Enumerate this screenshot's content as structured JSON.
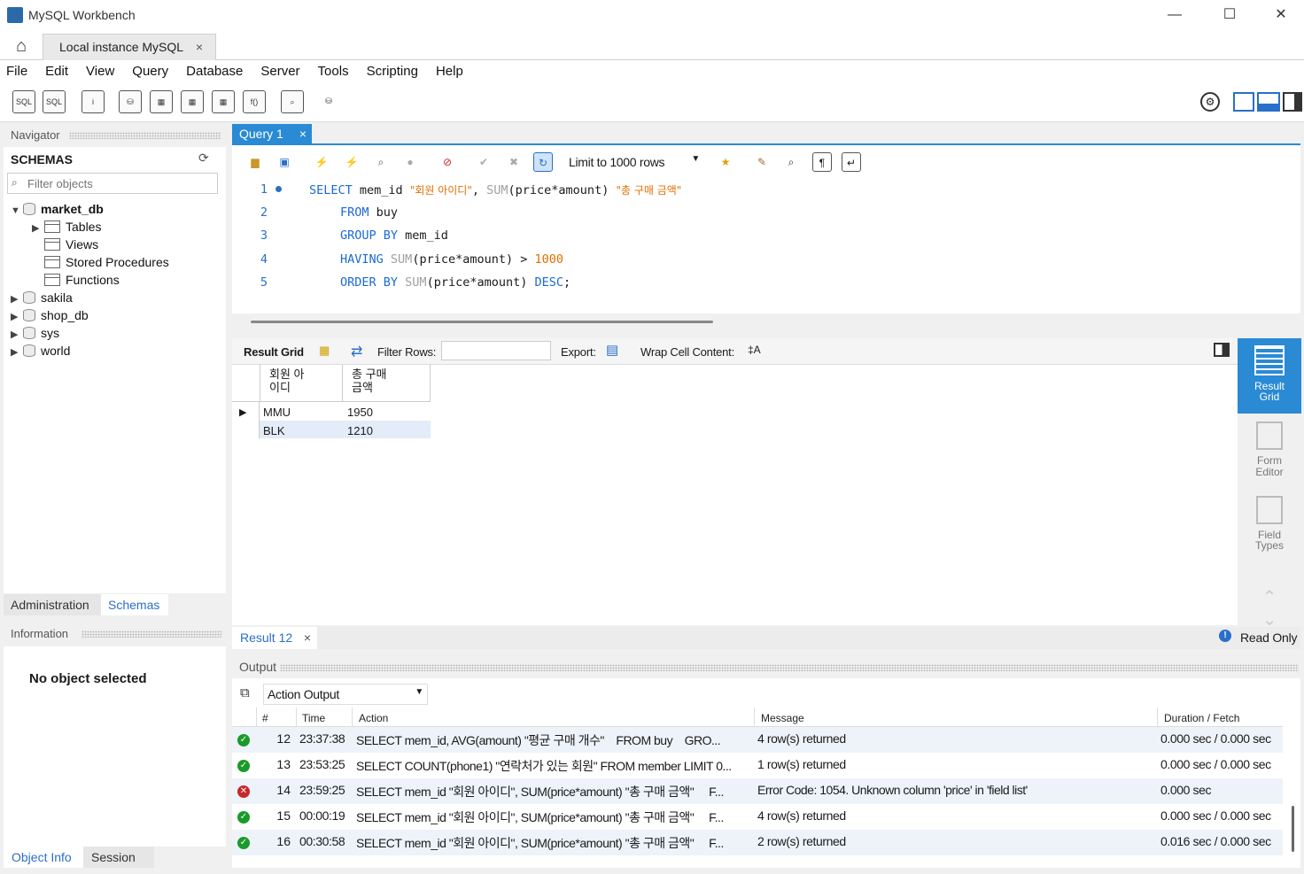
{
  "window": {
    "title": "MySQL Workbench",
    "minimize": "—",
    "maximize": "☐",
    "close": "✕"
  },
  "connection_tab": {
    "label": "Local instance MySQL",
    "close": "×"
  },
  "menu": [
    "File",
    "Edit",
    "View",
    "Query",
    "Database",
    "Server",
    "Tools",
    "Scripting",
    "Help"
  ],
  "navigator": {
    "header": "Navigator",
    "schemas_title": "SCHEMAS",
    "filter_placeholder": "Filter objects",
    "tree": {
      "market_db": "market_db",
      "tables": "Tables",
      "views": "Views",
      "procedures": "Stored Procedures",
      "functions": "Functions",
      "sakila": "sakila",
      "shop_db": "shop_db",
      "sys": "sys",
      "world": "world"
    },
    "tab_admin": "Administration",
    "tab_schemas": "Schemas"
  },
  "information": {
    "header": "Information",
    "message": "No object selected",
    "tab_objinfo": "Object Info",
    "tab_session": "Session"
  },
  "query_tab": {
    "label": "Query 1",
    "close": "×"
  },
  "limit": {
    "label": "Limit to 1000 rows"
  },
  "editor": {
    "line_numbers": [
      "1",
      "2",
      "3",
      "4",
      "5"
    ],
    "l1_kw": "SELECT",
    "l1_a": " mem_id ",
    "l1_s1": "\"회원 아이디\"",
    "l1_b": ", ",
    "l1_fn": "SUM",
    "l1_c": "(price*amount) ",
    "l1_s2": "\"총 구매 금액\"",
    "l2_kw": "FROM",
    "l2_a": " buy",
    "l3_kw": "GROUP BY",
    "l3_a": " mem_id",
    "l4_kw": "HAVING",
    "l4_fn": "SUM",
    "l4_a": "(price*amount) > ",
    "l4_num": "1000",
    "l5_kw": "ORDER BY",
    "l5_fn": "SUM",
    "l5_a": "(price*amount) ",
    "l5_kw2": "DESC",
    "l5_b": ";"
  },
  "result_toolbar": {
    "grid": "Result Grid",
    "filter": "Filter Rows:",
    "export": "Export:",
    "wrap": "Wrap Cell Content:"
  },
  "result_grid": {
    "col1_l1": "회원 아",
    "col1_l2": "이디",
    "col2_l1": "총 구매",
    "col2_l2": "금액",
    "rows": [
      [
        "MMU",
        "1950"
      ],
      [
        "BLK",
        "1210"
      ]
    ]
  },
  "side_panel": {
    "result_grid_1": "Result",
    "result_grid_2": "Grid",
    "form_1": "Form",
    "form_2": "Editor",
    "field_1": "Field",
    "field_2": "Types"
  },
  "result_tab": {
    "label": "Result 12",
    "close": "×",
    "status": "Read Only"
  },
  "output": {
    "header": "Output",
    "selector": "Action Output",
    "columns": [
      "#",
      "Time",
      "Action",
      "Message",
      "Duration / Fetch"
    ],
    "rows": [
      {
        "status": "ok",
        "num": "12",
        "time": "23:37:38",
        "action": "SELECT mem_id, AVG(amount) \"평균 구매 개수\"    FROM buy    GRO...",
        "message": "4 row(s) returned",
        "duration": "0.000 sec / 0.000 sec"
      },
      {
        "status": "ok",
        "num": "13",
        "time": "23:53:25",
        "action": "SELECT COUNT(phone1) \"연락처가 있는 회원\" FROM member LIMIT 0...",
        "message": "1 row(s) returned",
        "duration": "0.000 sec / 0.000 sec"
      },
      {
        "status": "err",
        "num": "14",
        "time": "23:59:25",
        "action": "SELECT mem_id \"회원 아이디\", SUM(price*amount) \"총 구매 금액\"     F...",
        "message": "Error Code: 1054. Unknown column 'price' in 'field list'",
        "duration": "0.000 sec"
      },
      {
        "status": "ok",
        "num": "15",
        "time": "00:00:19",
        "action": "SELECT mem_id \"회원 아이디\", SUM(price*amount) \"총 구매 금액\"     F...",
        "message": "4 row(s) returned",
        "duration": "0.000 sec / 0.000 sec"
      },
      {
        "status": "ok",
        "num": "16",
        "time": "00:30:58",
        "action": "SELECT mem_id \"회원 아이디\", SUM(price*amount) \"총 구매 금액\"     F...",
        "message": "2 row(s) returned",
        "duration": "0.016 sec / 0.000 sec"
      }
    ]
  },
  "colors": {
    "accent": "#2a8ad4",
    "ok": "#1a9a2a",
    "error": "#c82828",
    "keyword": "#1a6ad4",
    "string": "#e07000"
  }
}
